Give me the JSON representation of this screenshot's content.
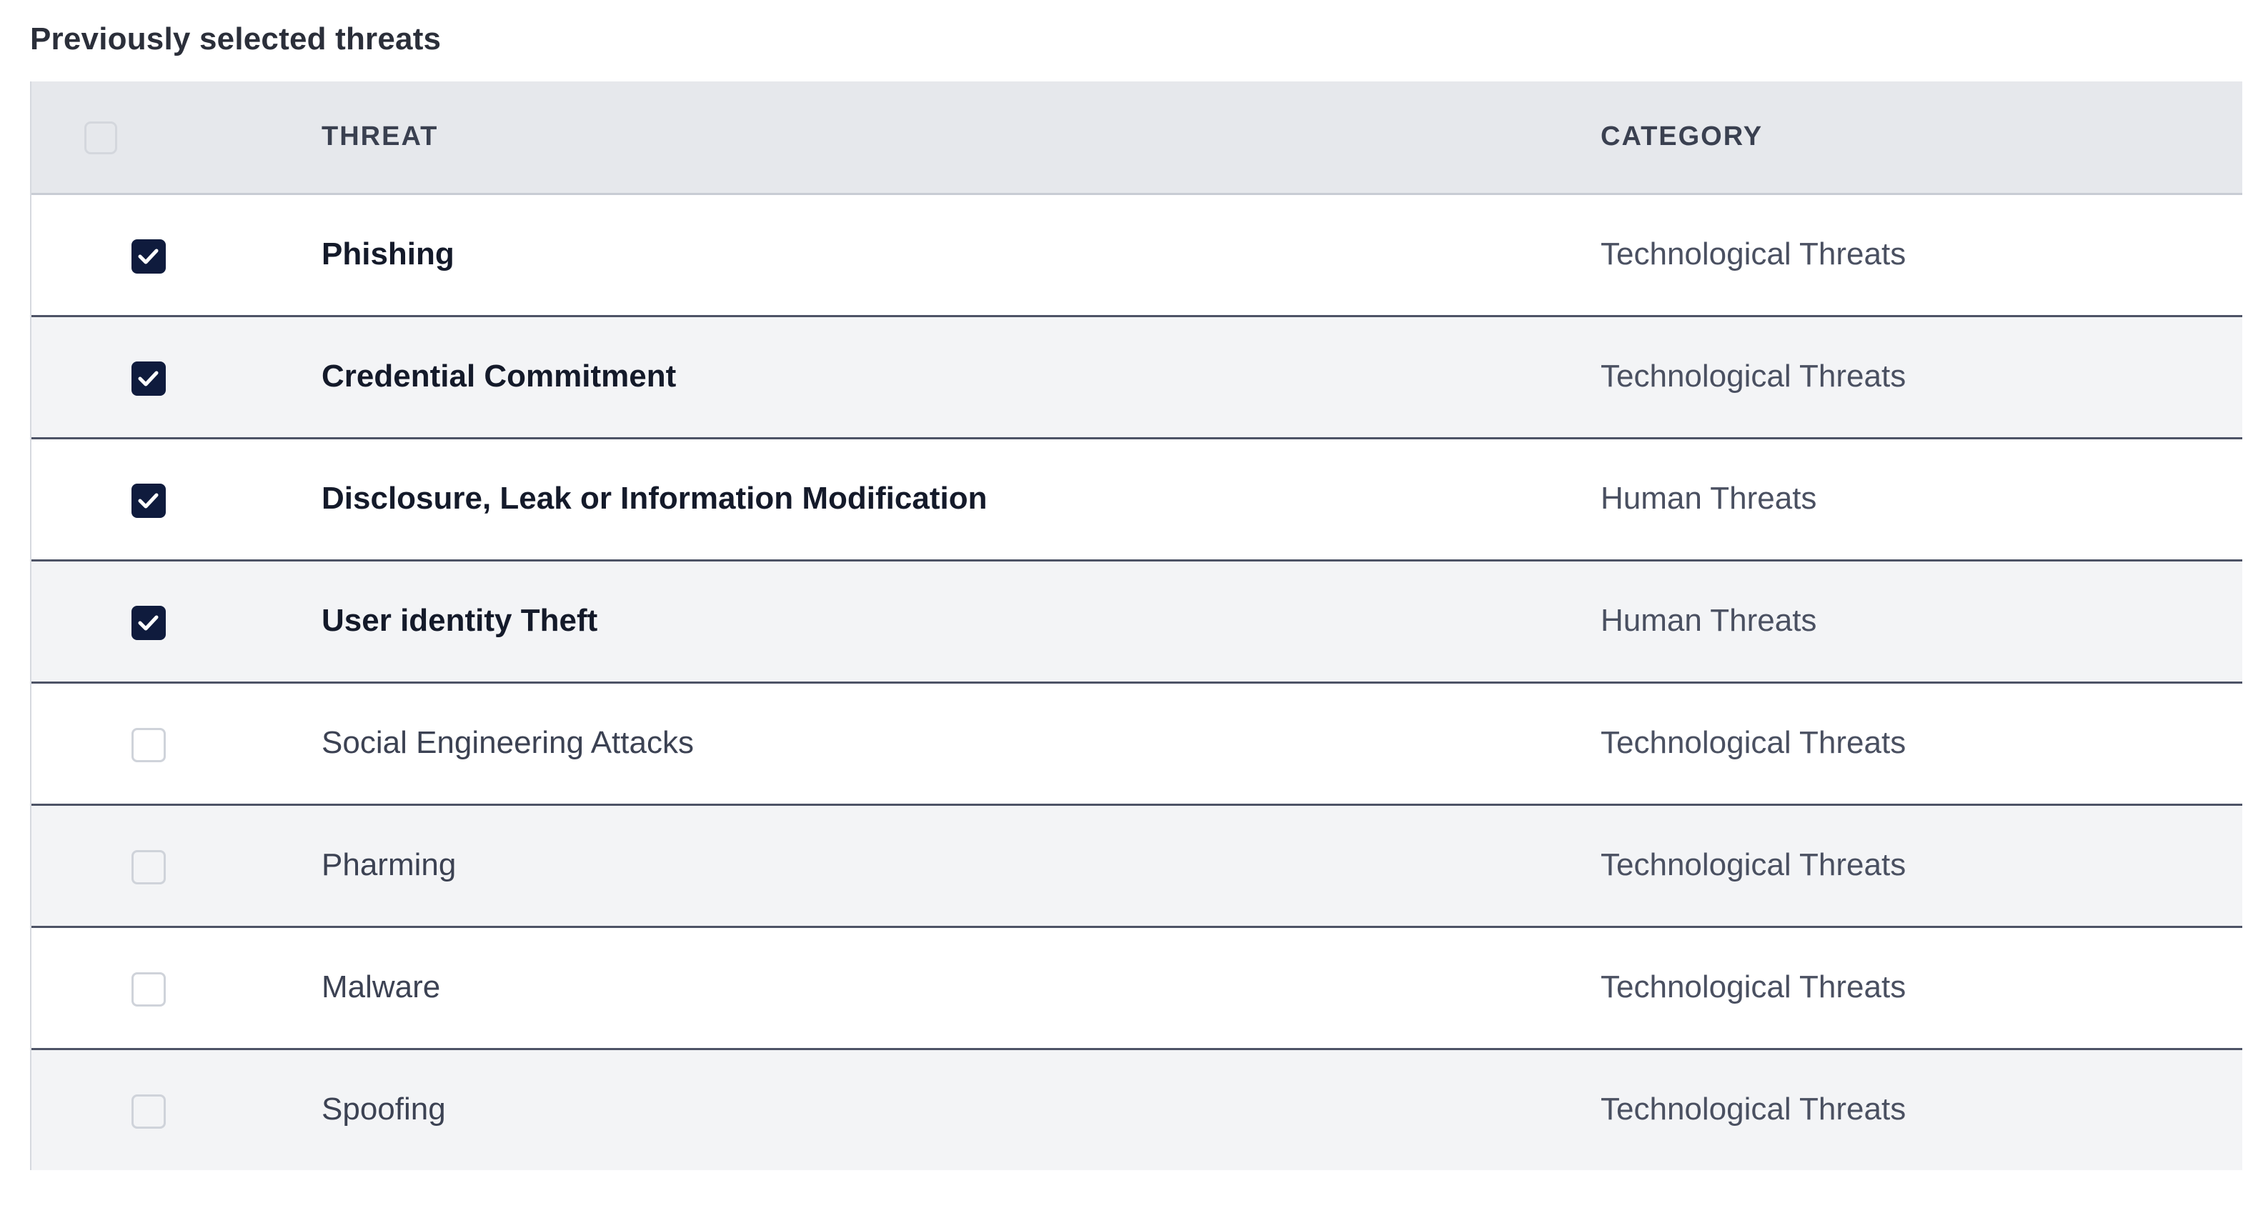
{
  "section_title": "Previously selected threats",
  "table": {
    "columns": {
      "threat": "THREAT",
      "category": "CATEGORY"
    },
    "rows": [
      {
        "threat": "Phishing",
        "category": "Technological Threats",
        "checked": true
      },
      {
        "threat": "Credential Commitment",
        "category": "Technological Threats",
        "checked": true
      },
      {
        "threat": "Disclosure, Leak or Information Modification",
        "category": "Human Threats",
        "checked": true
      },
      {
        "threat": "User identity Theft",
        "category": "Human Threats",
        "checked": true
      },
      {
        "threat": "Social Engineering Attacks",
        "category": "Technological Threats",
        "checked": false
      },
      {
        "threat": "Pharming",
        "category": "Technological Threats",
        "checked": false
      },
      {
        "threat": "Malware",
        "category": "Technological Threats",
        "checked": false
      },
      {
        "threat": "Spoofing",
        "category": "Technological Threats",
        "checked": false
      }
    ]
  },
  "colors": {
    "checked_fill": "#0f1b3d",
    "header_bg": "#e6e8ec",
    "stripe_bg": "#f3f4f6"
  },
  "icons": {
    "checkmark": "check-icon"
  }
}
